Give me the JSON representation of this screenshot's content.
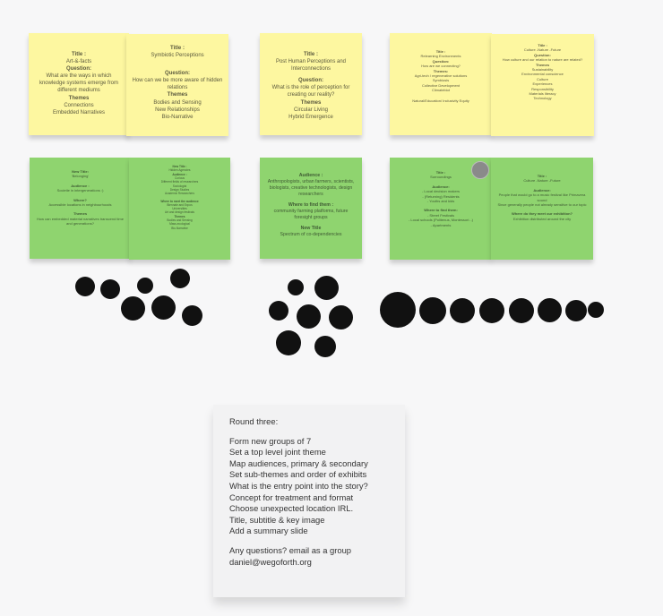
{
  "notes": {
    "y1": [
      "Title :",
      "Art-&-facts",
      "Question:",
      "What are the ways in which knowledge systems emerge from different mediums",
      "Themes",
      "Connections",
      "Embedded Narratives"
    ],
    "y2": [
      "Title :",
      "Symbiotic Perceptions",
      "Question:",
      "How can we be more aware of hidden relations",
      "Themes",
      "Bodies and Sensing",
      "New Relationships",
      "Bio-Narrative"
    ],
    "y3": [
      "Title :",
      "Post Human Perceptions and Interconnections",
      "Question:",
      "What is the role of perception for creating our reality?",
      "Themes",
      "Circular Living",
      "Hybrid Emergence"
    ],
    "y4": [
      "Title :",
      "Relearning Environments",
      "Question:",
      "How are we connecting?",
      "Themes:",
      "Agri-tech / regenerative solutions",
      "Symbiosis",
      "Collective Development",
      "Climatebiot",
      "",
      "Natural/Education/ Inclusivity Equity"
    ],
    "y5": [
      "Title :",
      "Culture -Nature -Future",
      "Question:",
      "How culture and our relation to nature are related?",
      "Themes",
      "Sustainability",
      "Environmental conscience",
      "Culture",
      "Experiences",
      "Responsibility",
      "Materials literacy",
      "Technology"
    ],
    "g1": [
      "New Title:",
      "'Belonging'",
      "Audience :",
      "Societie in intergenerations :)",
      "Where?",
      "Accessible locations in neighbourhoods",
      "Themes",
      "How can embedded material narratives transcend time and generations?"
    ],
    "g2": [
      "New Title :",
      "Hidden Agencies",
      "Audience :",
      "Curious",
      "Different fields of researchers",
      "Sociologist",
      "Design Studies",
      "Academic Researchers",
      "Where to meet the audience",
      "Biennale and Expos",
      "Universities",
      "Art and design festivals",
      "Themes",
      "Bodies and Sensing",
      "Mass-ecological",
      "Bio-Narrative"
    ],
    "g3": [
      "Audience :",
      "Anthropologists, urban farmers, scientists, biologists, creative technologists, design researchers",
      "Where to find them :",
      "community farming platforms, future foresight groups",
      "New Title",
      "Spectrum of co-dependencies"
    ],
    "g4": [
      "Title :",
      "Surroundings",
      "Audience:",
      "- Local decision makers",
      "- (Returning) Residents",
      "- Youths and kids",
      "Where to find them:",
      "- Street Festivals",
      "- Local schools (Politenus, Montessori...)",
      "- Apartments"
    ],
    "g5": [
      "Title :",
      "Culture -Nature -Future",
      "Audience:",
      "People that would go to a music festival like Primavera sound",
      "Since generally people not already sensitive to our topic",
      "Where do they meet our exhibition?",
      "Exhibition distributed around the city"
    ]
  },
  "round": {
    "heading": "Round three:",
    "items": [
      "Form new groups of 7",
      "Set a top level joint theme",
      "Map audiences, primary & secondary",
      "Set sub-themes and order of exhibits",
      "What is the entry point into the story?",
      "Concept for treatment and format",
      "Choose unexpected location IRL.",
      "Title, subtitle & key image",
      "Add a summary slide"
    ],
    "questions": "Any questions? email as a group",
    "email": "daniel@wegoforth.org"
  },
  "colors": {
    "yellow": "#fdf7a0",
    "green": "#8fd46f",
    "dot": "#111111"
  },
  "icons": {
    "dots": "voting-dot-icon"
  }
}
